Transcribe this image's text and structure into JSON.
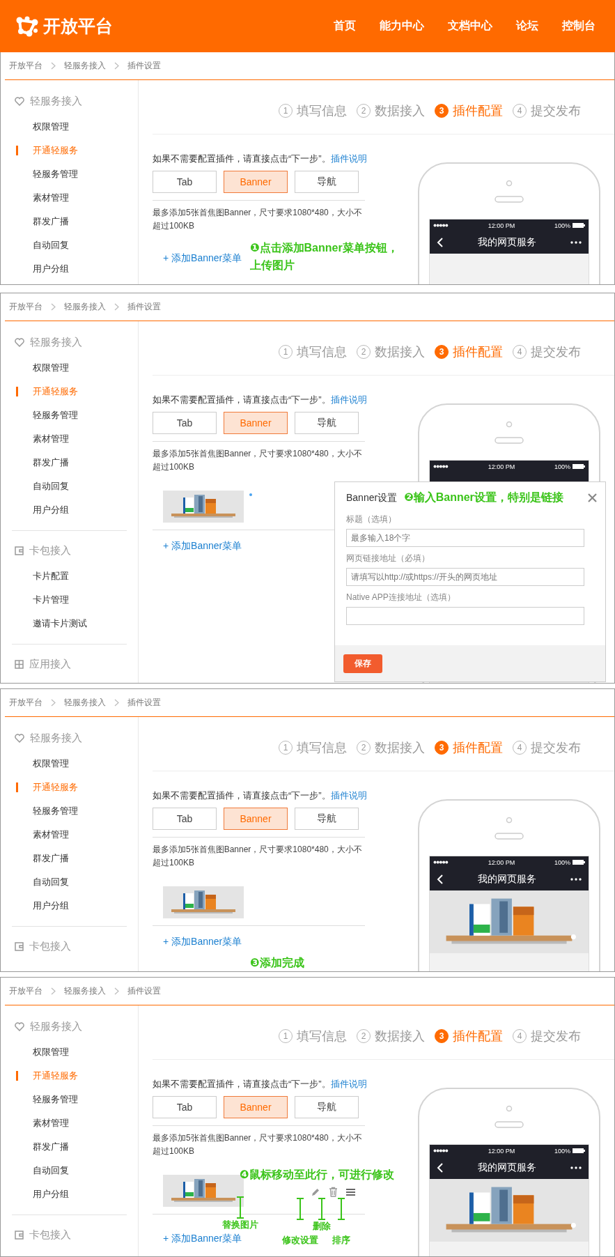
{
  "header": {
    "logo": "开放平台",
    "nav": [
      {
        "label": "首页"
      },
      {
        "label": "能力中心"
      },
      {
        "label": "文档中心"
      },
      {
        "label": "论坛"
      },
      {
        "label": "控制台"
      }
    ]
  },
  "panels": [
    {
      "breadcrumb": [
        "开放平台",
        "轻服务接入",
        "插件设置"
      ],
      "sidebar": [
        {
          "kind": "heart",
          "label": "轻服务接入",
          "items": [
            {
              "label": "权限管理",
              "selected": false
            },
            {
              "label": "开通轻服务",
              "selected": true
            },
            {
              "label": "轻服务管理",
              "selected": false
            },
            {
              "label": "素材管理",
              "selected": false
            },
            {
              "label": "群发广播",
              "selected": false
            },
            {
              "label": "自动回复",
              "selected": false
            },
            {
              "label": "用户分组",
              "selected": false
            }
          ]
        }
      ],
      "steps": [
        {
          "number": "1",
          "label": "填写信息",
          "selected": false
        },
        {
          "number": "2",
          "label": "数据接入",
          "selected": false
        },
        {
          "number": "3",
          "label": "插件配置",
          "selected": true
        },
        {
          "number": "4",
          "label": "提交发布",
          "selected": false
        }
      ],
      "intro": {
        "text": "如果不需要配置插件，请直接点击“下一步”。",
        "link": "插件说明"
      },
      "plugin_tabs": [
        {
          "label": "Tab",
          "selected": false
        },
        {
          "label": "Banner",
          "selected": true
        },
        {
          "label": "导航",
          "selected": false
        }
      ],
      "hint": "最多添加5张首焦图Banner，尺寸要求1080*480，大小不超过100KB",
      "add_link": "+ 添加Banner菜单",
      "annotation": "❶点击添加Banner菜单按钮，上传图片",
      "phone": {
        "time": "12:00 PM",
        "battery": "100%",
        "title": "我的网页服务",
        "banner": false
      }
    },
    {
      "breadcrumb": [
        "开放平台",
        "轻服务接入",
        "插件设置"
      ],
      "sidebar": [
        {
          "kind": "heart",
          "label": "轻服务接入",
          "items": [
            {
              "label": "权限管理",
              "selected": false
            },
            {
              "label": "开通轻服务",
              "selected": true
            },
            {
              "label": "轻服务管理",
              "selected": false
            },
            {
              "label": "素材管理",
              "selected": false
            },
            {
              "label": "群发广播",
              "selected": false
            },
            {
              "label": "自动回复",
              "selected": false
            },
            {
              "label": "用户分组",
              "selected": false
            }
          ]
        },
        {
          "kind": "card",
          "label": "卡包接入",
          "items": [
            {
              "label": "卡片配置",
              "selected": false
            },
            {
              "label": "卡片管理",
              "selected": false
            },
            {
              "label": "邀请卡片测试",
              "selected": false
            }
          ]
        },
        {
          "kind": "grid",
          "label": "应用接入"
        }
      ],
      "steps": [
        {
          "number": "1",
          "label": "填写信息",
          "selected": false
        },
        {
          "number": "2",
          "label": "数据接入",
          "selected": false
        },
        {
          "number": "3",
          "label": "插件配置",
          "selected": true
        },
        {
          "number": "4",
          "label": "提交发布",
          "selected": false
        }
      ],
      "intro": {
        "text": "如果不需要配置插件，请直接点击“下一步”。",
        "link": "插件说明"
      },
      "plugin_tabs": [
        {
          "label": "Tab",
          "selected": false
        },
        {
          "label": "Banner",
          "selected": true
        },
        {
          "label": "导航",
          "selected": false
        }
      ],
      "hint": "最多添加5张首焦图Banner，尺寸要求1080*480，大小不超过100KB",
      "banners": [
        {
          "kind": "picture",
          "pending": true,
          "hovered": false
        }
      ],
      "add_link": "+ 添加Banner菜单",
      "phone": {
        "time": "12:00 PM",
        "battery": "100%"
      },
      "dialog": {
        "title": "Banner设置",
        "annotation": "❷输入Banner设置，特别是链接",
        "fields": [
          {
            "label": "标题（选填）",
            "placeholder": "最多输入18个字"
          },
          {
            "label": "网页链接地址（必填）",
            "placeholder": "请填写以http://或https://开头的网页地址"
          },
          {
            "label": "Native APP连接地址（选填）"
          }
        ],
        "save": "保存"
      }
    },
    {
      "breadcrumb": [
        "开放平台",
        "轻服务接入",
        "插件设置"
      ],
      "sidebar": [
        {
          "kind": "heart",
          "label": "轻服务接入",
          "items": [
            {
              "label": "权限管理",
              "selected": false
            },
            {
              "label": "开通轻服务",
              "selected": true
            },
            {
              "label": "轻服务管理",
              "selected": false
            },
            {
              "label": "素材管理",
              "selected": false
            },
            {
              "label": "群发广播",
              "selected": false
            },
            {
              "label": "自动回复",
              "selected": false
            },
            {
              "label": "用户分组",
              "selected": false
            }
          ]
        },
        {
          "kind": "card",
          "label": "卡包接入"
        }
      ],
      "steps": [
        {
          "number": "1",
          "label": "填写信息",
          "selected": false
        },
        {
          "number": "2",
          "label": "数据接入",
          "selected": false
        },
        {
          "number": "3",
          "label": "插件配置",
          "selected": true
        },
        {
          "number": "4",
          "label": "提交发布",
          "selected": false
        }
      ],
      "intro": {
        "text": "如果不需要配置插件，请直接点击“下一步”。",
        "link": "插件说明"
      },
      "plugin_tabs": [
        {
          "label": "Tab",
          "selected": false
        },
        {
          "label": "Banner",
          "selected": true
        },
        {
          "label": "导航",
          "selected": false
        }
      ],
      "hint": "最多添加5张首焦图Banner，尺寸要求1080*480，大小不超过100KB",
      "banners": [
        {
          "kind": "picture",
          "pending": false,
          "hovered": false
        }
      ],
      "add_link": "+ 添加Banner菜单",
      "annotation": "❸添加完成",
      "phone": {
        "time": "12:00 PM",
        "battery": "100%",
        "title": "我的网页服务",
        "banner": true
      }
    },
    {
      "breadcrumb": [
        "开放平台",
        "轻服务接入",
        "插件设置"
      ],
      "sidebar": [
        {
          "kind": "heart",
          "label": "轻服务接入",
          "items": [
            {
              "label": "权限管理",
              "selected": false
            },
            {
              "label": "开通轻服务",
              "selected": true
            },
            {
              "label": "轻服务管理",
              "selected": false
            },
            {
              "label": "素材管理",
              "selected": false
            },
            {
              "label": "群发广播",
              "selected": false
            },
            {
              "label": "自动回复",
              "selected": false
            },
            {
              "label": "用户分组",
              "selected": false
            }
          ]
        },
        {
          "kind": "card",
          "label": "卡包接入"
        }
      ],
      "steps": [
        {
          "number": "1",
          "label": "填写信息",
          "selected": false
        },
        {
          "number": "2",
          "label": "数据接入",
          "selected": false
        },
        {
          "number": "3",
          "label": "插件配置",
          "selected": true
        },
        {
          "number": "4",
          "label": "提交发布",
          "selected": false
        }
      ],
      "intro": {
        "text": "如果不需要配置插件，请直接点击“下一步”。",
        "link": "插件说明"
      },
      "plugin_tabs": [
        {
          "label": "Tab",
          "selected": false
        },
        {
          "label": "Banner",
          "selected": true
        },
        {
          "label": "导航",
          "selected": false
        }
      ],
      "hint": "最多添加5张首焦图Banner，尺寸要求1080*480，大小不超过100KB",
      "banners": [
        {
          "kind": "picture",
          "pending": false,
          "hovered": true
        }
      ],
      "add_link": "+ 添加Banner菜单",
      "annotation": "❹鼠标移动至此行，可进行修改",
      "callouts": [
        {
          "label": "替换图片"
        },
        {
          "label": "修改设置"
        },
        {
          "label": "删除"
        },
        {
          "label": "排序"
        }
      ],
      "phone": {
        "time": "12:00 PM",
        "battery": "100%",
        "title": "我的网页服务",
        "banner": true
      }
    }
  ]
}
